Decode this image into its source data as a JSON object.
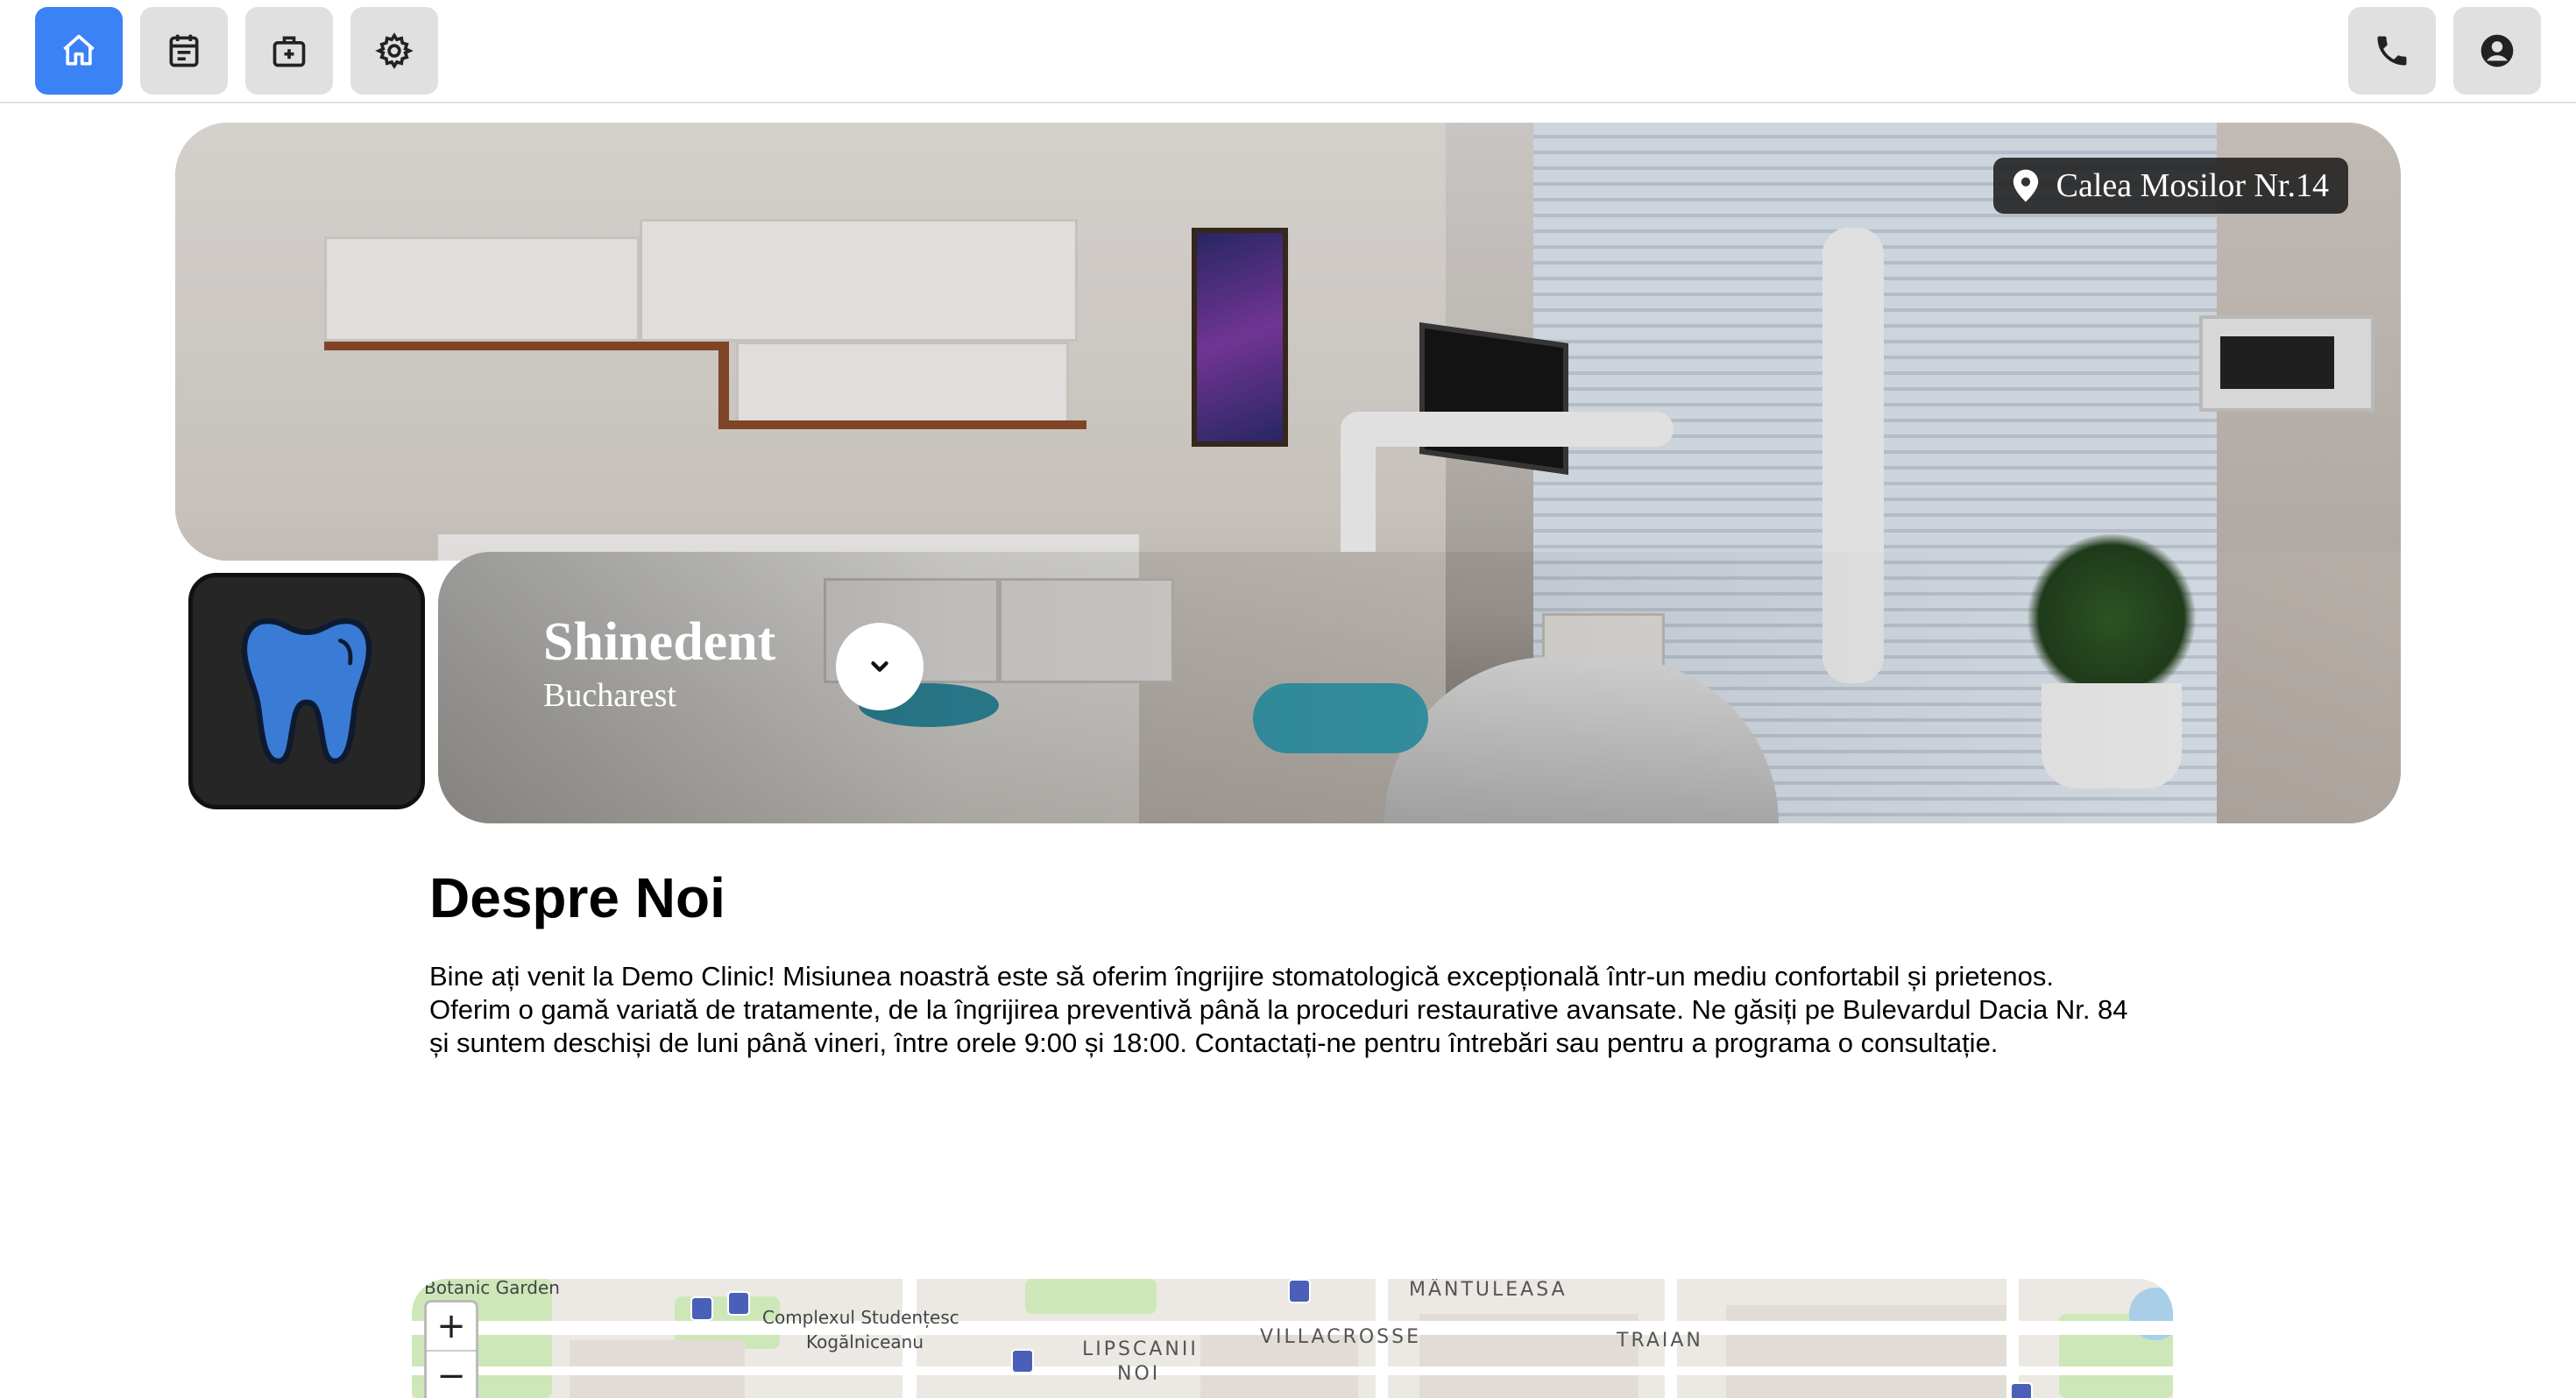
{
  "nav": {
    "left": [
      {
        "name": "home-icon",
        "active": true
      },
      {
        "name": "calendar-icon",
        "active": false
      },
      {
        "name": "medical-kit-icon",
        "active": false
      },
      {
        "name": "gear-icon",
        "active": false
      }
    ],
    "right": [
      {
        "name": "phone-icon"
      },
      {
        "name": "account-icon"
      }
    ]
  },
  "hero": {
    "address": "Calea Mosilor Nr.14",
    "address_icon": "location-pin-icon",
    "logo_icon": "tooth-icon",
    "name": "Shinedent",
    "city": "Bucharest",
    "expand_icon": "chevron-down-icon"
  },
  "about": {
    "title": "Despre Noi",
    "text": "Bine ați venit la Demo Clinic! Misiunea noastră este să oferim îngrijire stomatologică excepțională într-un mediu confortabil și prietenos. Oferim o gamă variată de tratamente, de la îngrijirea preventivă până la proceduri restaurative avansate. Ne găsiți pe Bulevardul Dacia Nr. 84 și suntem deschiși de luni până vineri, între orele 9:00 și 18:00. Contactați-ne pentru întrebări sau pentru a programa o consultație."
  },
  "map": {
    "labels": {
      "botanic": "Botanic Garden",
      "complex_line1": "Complexul Studențesc",
      "complex_line2": "Kogălniceanu",
      "lipscanii_line1": "LIPSCANII",
      "lipscanii_line2": "NOI",
      "villacrosse": "VILLACROSSE",
      "mantuleasa": "MÂNTULEASA",
      "traian": "TRAIAN"
    },
    "zoom_in": "+",
    "zoom_out": "−"
  },
  "colors": {
    "accent": "#3b82f6",
    "nav_button": "#e0e0e0",
    "tooth": "#3a7bd5"
  }
}
